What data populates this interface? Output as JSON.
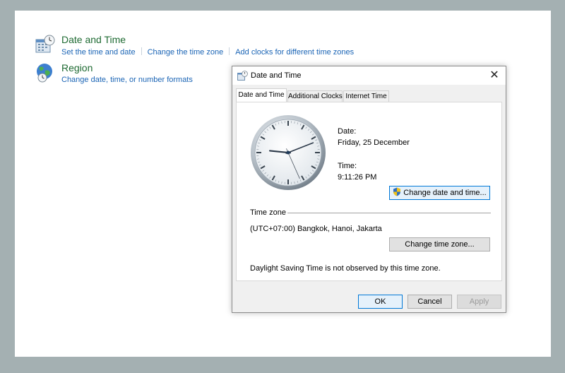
{
  "control_panel": {
    "date_time": {
      "title": "Date and Time",
      "links": [
        "Set the time and date",
        "Change the time zone",
        "Add clocks for different time zones"
      ]
    },
    "region": {
      "title": "Region",
      "links": [
        "Change date, time, or number formats"
      ]
    }
  },
  "dialog": {
    "title": "Date and Time",
    "close_label": "✕",
    "tabs": [
      "Date and Time",
      "Additional Clocks",
      "Internet Time"
    ],
    "active_tab": "Date and Time",
    "date_label": "Date:",
    "date_value": "Friday, 25 December",
    "time_label": "Time:",
    "time_value": "9:11:26 PM",
    "change_datetime_button": "Change date and time...",
    "timezone_header": "Time zone",
    "timezone_value": "(UTC+07:00) Bangkok, Hanoi, Jakarta",
    "change_timezone_button": "Change time zone...",
    "dst_note": "Daylight Saving Time is not observed by this time zone.",
    "ok_button": "OK",
    "cancel_button": "Cancel",
    "apply_button": "Apply"
  },
  "clock": {
    "hour": 9,
    "minute": 11,
    "second": 26
  },
  "colors": {
    "link": "#1a64b5",
    "title_green": "#1e6a32",
    "focus_border": "#0078d7"
  },
  "icons": [
    "calendar-clock-icon",
    "globe-clock-icon",
    "date-time-small-icon",
    "uac-shield-icon",
    "close-icon"
  ]
}
